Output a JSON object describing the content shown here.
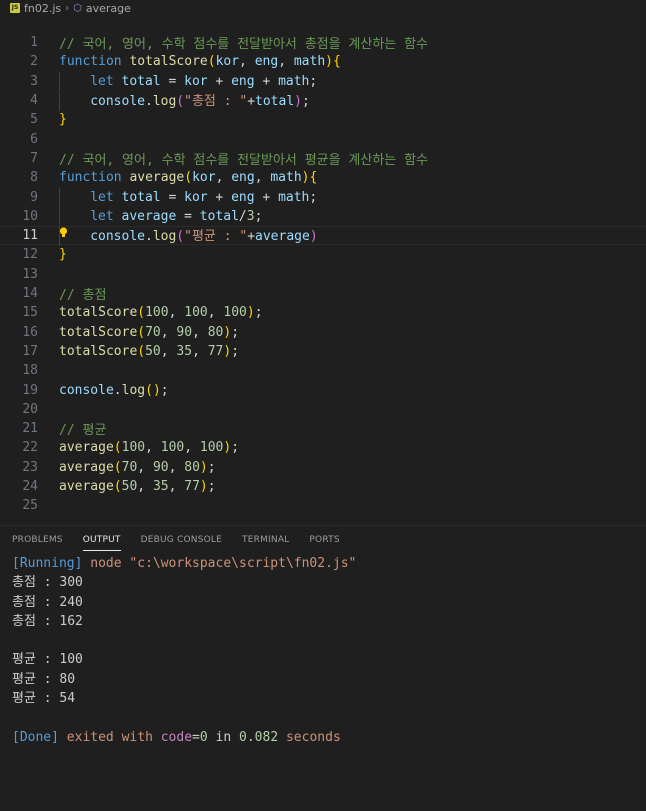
{
  "breadcrumb": {
    "file_badge": "JS",
    "file": "fn02.js",
    "symbol": "average"
  },
  "editor": {
    "lines": [
      {
        "n": "1",
        "tokens": [
          [
            "t-comment",
            "// 국어, 영어, 수학 점수를 전달받아서 총점을 계산하는 함수"
          ]
        ]
      },
      {
        "n": "2",
        "tokens": [
          [
            "t-kw",
            "function"
          ],
          [
            "t-plain",
            " "
          ],
          [
            "t-fn",
            "totalScore"
          ],
          [
            "b1",
            "("
          ],
          [
            "t-var",
            "kor"
          ],
          [
            "t-plain",
            ", "
          ],
          [
            "t-var",
            "eng"
          ],
          [
            "t-plain",
            ", "
          ],
          [
            "t-var",
            "math"
          ],
          [
            "b1",
            ")"
          ],
          [
            "b1",
            "{"
          ]
        ]
      },
      {
        "n": "3",
        "indent": 1,
        "tokens": [
          [
            "t-kw",
            "let"
          ],
          [
            "t-plain",
            " "
          ],
          [
            "t-var",
            "total"
          ],
          [
            "t-plain",
            " = "
          ],
          [
            "t-var",
            "kor"
          ],
          [
            "t-plain",
            " + "
          ],
          [
            "t-var",
            "eng"
          ],
          [
            "t-plain",
            " + "
          ],
          [
            "t-var",
            "math"
          ],
          [
            "t-plain",
            ";"
          ]
        ]
      },
      {
        "n": "4",
        "indent": 1,
        "tokens": [
          [
            "t-var",
            "console"
          ],
          [
            "t-plain",
            "."
          ],
          [
            "t-fn",
            "log"
          ],
          [
            "b2",
            "("
          ],
          [
            "t-str",
            "\"총점 : \""
          ],
          [
            "t-plain",
            "+"
          ],
          [
            "t-var",
            "total"
          ],
          [
            "b2",
            ")"
          ],
          [
            "t-plain",
            ";"
          ]
        ]
      },
      {
        "n": "5",
        "tokens": [
          [
            "b1",
            "}"
          ]
        ]
      },
      {
        "n": "6",
        "tokens": []
      },
      {
        "n": "7",
        "tokens": [
          [
            "t-comment",
            "// 국어, 영어, 수학 점수를 전달받아서 평균을 계산하는 함수"
          ]
        ]
      },
      {
        "n": "8",
        "tokens": [
          [
            "t-kw",
            "function"
          ],
          [
            "t-plain",
            " "
          ],
          [
            "t-fn",
            "average"
          ],
          [
            "b1",
            "("
          ],
          [
            "t-var",
            "kor"
          ],
          [
            "t-plain",
            ", "
          ],
          [
            "t-var",
            "eng"
          ],
          [
            "t-plain",
            ", "
          ],
          [
            "t-var",
            "math"
          ],
          [
            "b1",
            ")"
          ],
          [
            "b1",
            "{"
          ]
        ]
      },
      {
        "n": "9",
        "indent": 1,
        "tokens": [
          [
            "t-kw",
            "let"
          ],
          [
            "t-plain",
            " "
          ],
          [
            "t-var",
            "total"
          ],
          [
            "t-plain",
            " = "
          ],
          [
            "t-var",
            "kor"
          ],
          [
            "t-plain",
            " + "
          ],
          [
            "t-var",
            "eng"
          ],
          [
            "t-plain",
            " + "
          ],
          [
            "t-var",
            "math"
          ],
          [
            "t-plain",
            ";"
          ]
        ]
      },
      {
        "n": "10",
        "indent": 1,
        "tokens": [
          [
            "t-kw",
            "let"
          ],
          [
            "t-plain",
            " "
          ],
          [
            "t-var",
            "average"
          ],
          [
            "t-plain",
            " = "
          ],
          [
            "t-var",
            "total"
          ],
          [
            "t-plain",
            "/"
          ],
          [
            "t-num",
            "3"
          ],
          [
            "t-plain",
            ";"
          ]
        ]
      },
      {
        "n": "11",
        "indent": 1,
        "current": true,
        "bulb": true,
        "tokens": [
          [
            "t-var",
            "console"
          ],
          [
            "t-plain",
            "."
          ],
          [
            "t-fn",
            "log"
          ],
          [
            "b2",
            "("
          ],
          [
            "t-str",
            "\"평균 : \""
          ],
          [
            "t-plain",
            "+"
          ],
          [
            "t-var",
            "average"
          ],
          [
            "b2",
            ")"
          ]
        ]
      },
      {
        "n": "12",
        "tokens": [
          [
            "b1",
            "}"
          ]
        ]
      },
      {
        "n": "13",
        "tokens": []
      },
      {
        "n": "14",
        "tokens": [
          [
            "t-comment",
            "// 총점"
          ]
        ]
      },
      {
        "n": "15",
        "tokens": [
          [
            "t-fn",
            "totalScore"
          ],
          [
            "b1",
            "("
          ],
          [
            "t-num",
            "100"
          ],
          [
            "t-plain",
            ", "
          ],
          [
            "t-num",
            "100"
          ],
          [
            "t-plain",
            ", "
          ],
          [
            "t-num",
            "100"
          ],
          [
            "b1",
            ")"
          ],
          [
            "t-plain",
            ";"
          ]
        ]
      },
      {
        "n": "16",
        "tokens": [
          [
            "t-fn",
            "totalScore"
          ],
          [
            "b1",
            "("
          ],
          [
            "t-num",
            "70"
          ],
          [
            "t-plain",
            ", "
          ],
          [
            "t-num",
            "90"
          ],
          [
            "t-plain",
            ", "
          ],
          [
            "t-num",
            "80"
          ],
          [
            "b1",
            ")"
          ],
          [
            "t-plain",
            ";"
          ]
        ]
      },
      {
        "n": "17",
        "tokens": [
          [
            "t-fn",
            "totalScore"
          ],
          [
            "b1",
            "("
          ],
          [
            "t-num",
            "50"
          ],
          [
            "t-plain",
            ", "
          ],
          [
            "t-num",
            "35"
          ],
          [
            "t-plain",
            ", "
          ],
          [
            "t-num",
            "77"
          ],
          [
            "b1",
            ")"
          ],
          [
            "t-plain",
            ";"
          ]
        ]
      },
      {
        "n": "18",
        "tokens": []
      },
      {
        "n": "19",
        "tokens": [
          [
            "t-var",
            "console"
          ],
          [
            "t-plain",
            "."
          ],
          [
            "t-fn",
            "log"
          ],
          [
            "b1",
            "("
          ],
          [
            "b1",
            ")"
          ],
          [
            "t-plain",
            ";"
          ]
        ]
      },
      {
        "n": "20",
        "tokens": []
      },
      {
        "n": "21",
        "tokens": [
          [
            "t-comment",
            "// 평균"
          ]
        ]
      },
      {
        "n": "22",
        "tokens": [
          [
            "t-fn",
            "average"
          ],
          [
            "b1",
            "("
          ],
          [
            "t-num",
            "100"
          ],
          [
            "t-plain",
            ", "
          ],
          [
            "t-num",
            "100"
          ],
          [
            "t-plain",
            ", "
          ],
          [
            "t-num",
            "100"
          ],
          [
            "b1",
            ")"
          ],
          [
            "t-plain",
            ";"
          ]
        ]
      },
      {
        "n": "23",
        "tokens": [
          [
            "t-fn",
            "average"
          ],
          [
            "b1",
            "("
          ],
          [
            "t-num",
            "70"
          ],
          [
            "t-plain",
            ", "
          ],
          [
            "t-num",
            "90"
          ],
          [
            "t-plain",
            ", "
          ],
          [
            "t-num",
            "80"
          ],
          [
            "b1",
            ")"
          ],
          [
            "t-plain",
            ";"
          ]
        ]
      },
      {
        "n": "24",
        "tokens": [
          [
            "t-fn",
            "average"
          ],
          [
            "b1",
            "("
          ],
          [
            "t-num",
            "50"
          ],
          [
            "t-plain",
            ", "
          ],
          [
            "t-num",
            "35"
          ],
          [
            "t-plain",
            ", "
          ],
          [
            "t-num",
            "77"
          ],
          [
            "b1",
            ")"
          ],
          [
            "t-plain",
            ";"
          ]
        ]
      },
      {
        "n": "25",
        "tokens": []
      }
    ]
  },
  "panel": {
    "tabs": [
      {
        "label": "PROBLEMS",
        "active": false
      },
      {
        "label": "OUTPUT",
        "active": true
      },
      {
        "label": "DEBUG CONSOLE",
        "active": false
      },
      {
        "label": "TERMINAL",
        "active": false
      },
      {
        "label": "PORTS",
        "active": false
      }
    ],
    "output": [
      [
        [
          "o-run",
          "[Running]"
        ],
        [
          "o-node",
          " node \"c:\\workspace\\script\\fn02.js\""
        ]
      ],
      [
        [
          "o-plain",
          "총점 : 300"
        ]
      ],
      [
        [
          "o-plain",
          "총점 : 240"
        ]
      ],
      [
        [
          "o-plain",
          "총점 : 162"
        ]
      ],
      [],
      [
        [
          "o-plain",
          "평균 : 100"
        ]
      ],
      [
        [
          "o-plain",
          "평균 : 80"
        ]
      ],
      [
        [
          "o-plain",
          "평균 : 54"
        ]
      ],
      [],
      [
        [
          "o-done",
          "[Done]"
        ],
        [
          "o-exit",
          " exited "
        ],
        [
          "o-exit",
          "with "
        ],
        [
          "o-kw",
          "code"
        ],
        [
          "o-in",
          "="
        ],
        [
          "o-num",
          "0"
        ],
        [
          "o-in",
          " in "
        ],
        [
          "o-num",
          "0.082"
        ],
        [
          "o-exit",
          " seconds"
        ]
      ]
    ]
  },
  "colors": {
    "background": "#1f1f1f",
    "comment": "#6a9955",
    "keyword": "#569cd6",
    "function": "#dcdcaa",
    "variable": "#9cdcfe",
    "string": "#ce9178",
    "number": "#b5cea8",
    "bracket_level1": "#ffd700",
    "bracket_level2": "#da70d6",
    "lightbulb": "#ffcc00"
  }
}
